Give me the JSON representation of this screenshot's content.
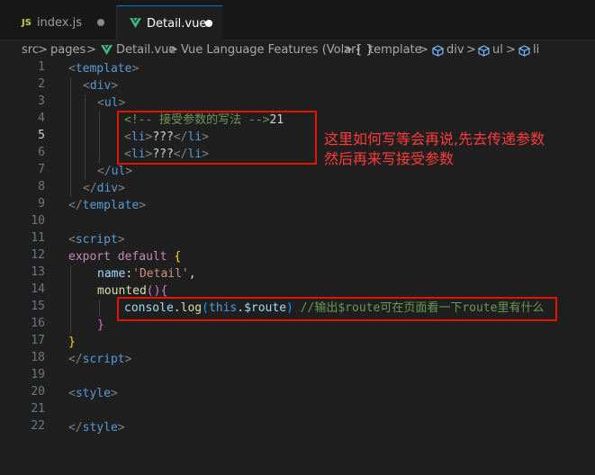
{
  "tabs": [
    {
      "icon": "JS",
      "label": "index.js"
    },
    {
      "label": "Detail.vue"
    }
  ],
  "breadcrumb": {
    "src": "src",
    "pages": "pages",
    "file": "Detail.vue",
    "lang": "Vue Language Features (Volar)",
    "template": "template",
    "div": "div",
    "ul": "ul",
    "li": "li",
    "sep": ">",
    "braces": "{ }"
  },
  "line_numbers": [
    "1",
    "2",
    "3",
    "4",
    "5",
    "6",
    "7",
    "8",
    "9",
    "10",
    "11",
    "12",
    "13",
    "14",
    "15",
    "16",
    "17",
    "18",
    "19",
    "20",
    "21",
    "22"
  ],
  "code": {
    "l1": [
      "<",
      "template",
      ">"
    ],
    "l2": [
      "<",
      "div",
      ">"
    ],
    "l3": [
      "<",
      "ul",
      ">"
    ],
    "l4": [
      "<!-- 接受参数的写法 -->",
      "21"
    ],
    "l5": [
      "<",
      "li",
      ">",
      "???",
      "</",
      "li",
      ">"
    ],
    "l6": [
      "<",
      "li",
      ">",
      "???",
      "</",
      "li",
      ">"
    ],
    "l7": [
      "</",
      "ul",
      ">"
    ],
    "l8": [
      "</",
      "div",
      ">"
    ],
    "l9": [
      "</",
      "template",
      ">"
    ],
    "l11": [
      "<",
      "script",
      ">"
    ],
    "l12": [
      "export",
      " ",
      "default",
      " ",
      "{"
    ],
    "l13": [
      "name",
      ":",
      "'Detail'",
      ","
    ],
    "l14": [
      "mounted",
      "(){"
    ],
    "l15": [
      "console",
      ".",
      "log",
      "(",
      "this",
      ".",
      "$route",
      ")",
      " //输出$route可在页面看一下route里有什么"
    ],
    "l16": [
      "}"
    ],
    "l17": [
      "}"
    ],
    "l18": [
      "</",
      "script",
      ">"
    ],
    "l20": [
      "<",
      "style",
      ">"
    ],
    "l22": [
      "</",
      "style",
      ">"
    ]
  },
  "annotation": {
    "line1": "这里如何写等会再说,先去传递参数",
    "line2": "然后再来写接受参数"
  },
  "colors": {
    "background": "#1f1f1f",
    "annotation": "#e51400",
    "tag": "#569cd6",
    "comment": "#6a9955"
  }
}
